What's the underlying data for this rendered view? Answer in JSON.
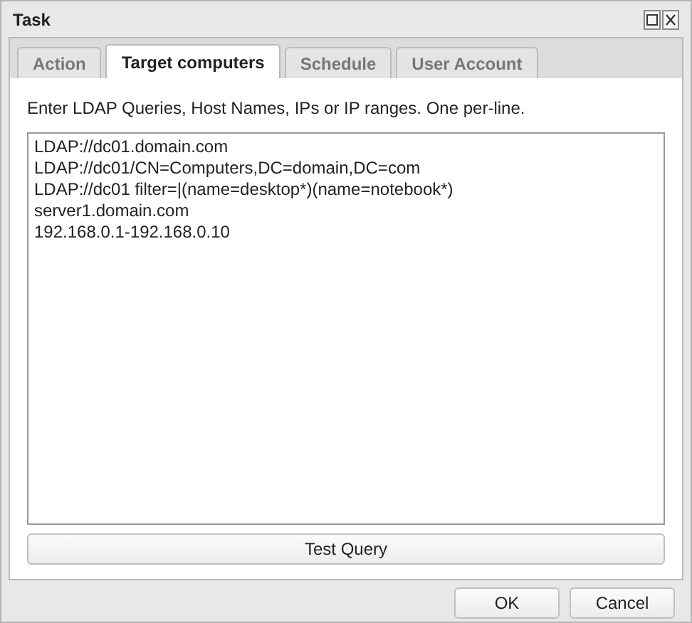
{
  "window": {
    "title": "Task"
  },
  "tabs": [
    {
      "label": "Action",
      "selected": false
    },
    {
      "label": "Target computers",
      "selected": true
    },
    {
      "label": "Schedule",
      "selected": false
    },
    {
      "label": "User Account",
      "selected": false
    }
  ],
  "instructions": "Enter LDAP Queries, Host Names, IPs or IP ranges. One per-line.",
  "targets": {
    "value": [
      "LDAP://dc01.domain.com",
      "LDAP://dc01/CN=Computers,DC=domain,DC=com",
      "LDAP://dc01 filter=|(name=desktop*)(name=notebook*)",
      "server1.domain.com",
      "192.168.0.1-192.168.0.10"
    ]
  },
  "test_button": "Test Query",
  "buttons": [
    "OK",
    "Cancel"
  ]
}
